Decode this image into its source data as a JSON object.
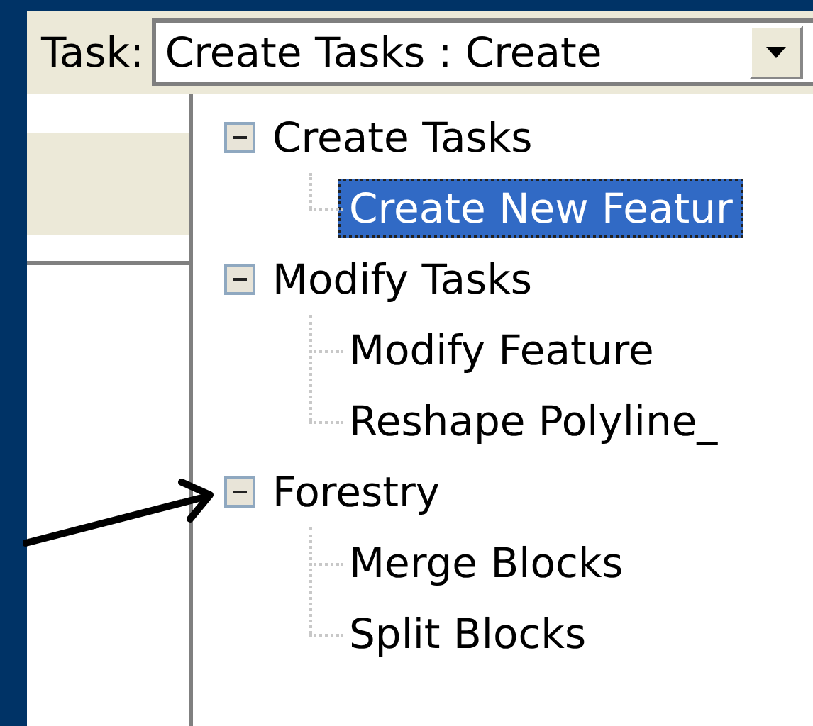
{
  "toolbar": {
    "label": "Task:",
    "combobox": {
      "value": "Create Tasks : Create"
    }
  },
  "task_tree": [
    {
      "label": "Create Tasks",
      "expanded": true,
      "children": [
        {
          "label": "Create New Featur",
          "selected": true
        }
      ]
    },
    {
      "label": "Modify Tasks",
      "expanded": true,
      "children": [
        {
          "label": "Modify Feature",
          "selected": false
        },
        {
          "label": "Reshape Polyline_",
          "selected": false
        }
      ]
    },
    {
      "label": "Forestry",
      "expanded": true,
      "children": [
        {
          "label": "Merge Blocks",
          "selected": false
        },
        {
          "label": "Split Blocks",
          "selected": false
        }
      ]
    }
  ]
}
